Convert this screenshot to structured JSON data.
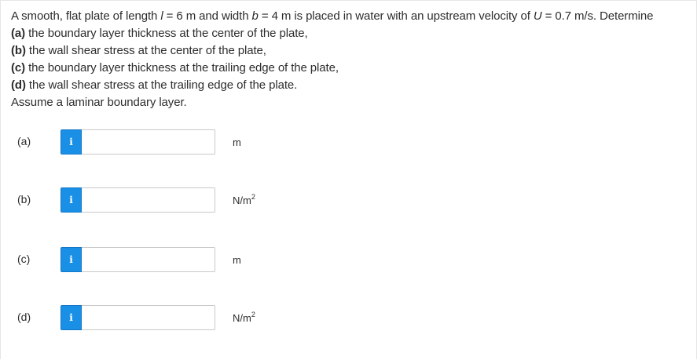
{
  "problem": {
    "intro_pre": "A smooth, flat plate of length ",
    "length_symbol": "l",
    "length_value": " = 6 m and width ",
    "width_symbol": "b",
    "width_value": " = 4 m is placed in water with an upstream velocity of ",
    "velocity_symbol": "U",
    "velocity_value": " = 0.7 m/s. Determine",
    "parts": [
      {
        "letter": "(a)",
        "text": " the boundary layer thickness at the center of the plate,"
      },
      {
        "letter": "(b)",
        "text": " the wall shear stress at the center of the plate,"
      },
      {
        "letter": "(c)",
        "text": " the boundary layer thickness at the trailing edge of the plate,"
      },
      {
        "letter": "(d)",
        "text": " the wall shear stress at the trailing edge of the plate."
      }
    ],
    "assumption": "Assume a laminar boundary layer."
  },
  "answers": [
    {
      "label": "(a)",
      "info_icon": "i",
      "value": "",
      "unit": "m",
      "unit_exp": ""
    },
    {
      "label": "(b)",
      "info_icon": "i",
      "value": "",
      "unit": "N/m",
      "unit_exp": "2"
    },
    {
      "label": "(c)",
      "info_icon": "i",
      "value": "",
      "unit": "m",
      "unit_exp": ""
    },
    {
      "label": "(d)",
      "info_icon": "i",
      "value": "",
      "unit": "N/m",
      "unit_exp": "2"
    }
  ],
  "colors": {
    "info_button": "#1a8fe6",
    "text": "#2d2d2d",
    "input_border": "#c9c9c9"
  }
}
